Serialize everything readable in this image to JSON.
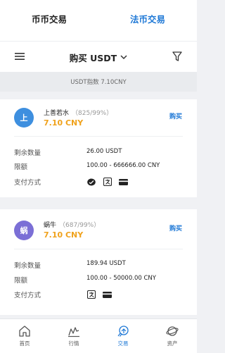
{
  "tabs": [
    {
      "label": "币币交易",
      "active": false
    },
    {
      "label": "法币交易",
      "active": true
    }
  ],
  "subheader": {
    "menu_icon": "menu-icon",
    "buy_selector": "购买 USDT",
    "filter_icon": "filter-icon"
  },
  "index_text": "USDT指数 7.10CNY",
  "offers": [
    {
      "avatar_char": "上",
      "avatar_color": "#3e8fdf",
      "name": "上善若水",
      "stats": "（825/99%）",
      "price": "7.10 CNY",
      "buy_label": "购买",
      "rows": [
        {
          "label": "剩余数量",
          "value": "26.00 USDT"
        },
        {
          "label": "限额",
          "value": "100.00 - 666666.00 CNY"
        }
      ],
      "pay_label": "支付方式",
      "pay_methods": [
        "wechat-pay-icon",
        "alipay-icon",
        "bank-card-icon"
      ]
    },
    {
      "avatar_char": "蜗",
      "avatar_color": "#7b6fd6",
      "name": "蜗牛",
      "stats": "（687/99%）",
      "price": "7.10 CNY",
      "buy_label": "购买",
      "rows": [
        {
          "label": "剩余数量",
          "value": "189.94 USDT"
        },
        {
          "label": "限额",
          "value": "100.00 - 50000.00 CNY"
        }
      ],
      "pay_label": "支付方式",
      "pay_methods": [
        "alipay-icon",
        "bank-card-icon"
      ]
    }
  ],
  "bottom_nav": [
    {
      "label": "首页",
      "icon": "home-icon",
      "active": false
    },
    {
      "label": "行情",
      "icon": "market-chart-icon",
      "active": false
    },
    {
      "label": "交易",
      "icon": "trade-rocket-icon",
      "active": true
    },
    {
      "label": "资产",
      "icon": "assets-planet-icon",
      "active": false
    }
  ],
  "colors": {
    "accent": "#1e78d6",
    "price": "#f0a21c",
    "background": "#f0f1f4"
  }
}
